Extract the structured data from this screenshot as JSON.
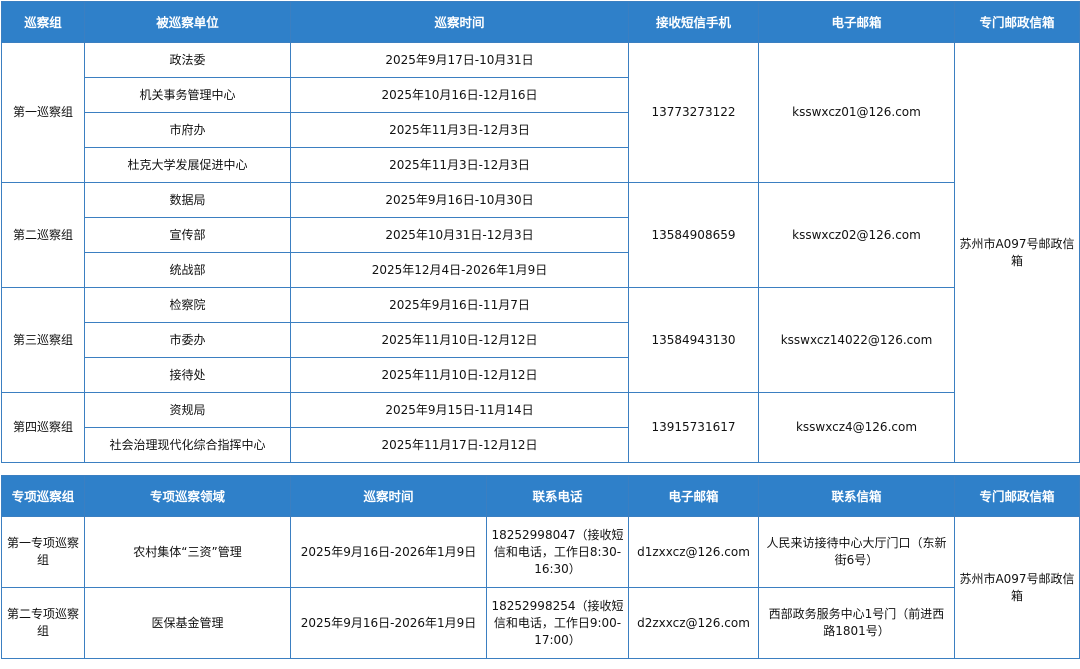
{
  "main_table": {
    "headers": [
      "巡察组",
      "被巡察单位",
      "巡察时间",
      "接收短信手机",
      "电子邮箱",
      "专门邮政信箱"
    ],
    "mailbox": "苏州市A097号邮政信箱",
    "groups": [
      {
        "name": "第一巡察组",
        "phone": "13773273122",
        "email": "ksswxcz01@126.com",
        "units": [
          {
            "unit": "政法委",
            "time": "2025年9月17日-10月31日"
          },
          {
            "unit": "机关事务管理中心",
            "time": "2025年10月16日-12月16日"
          },
          {
            "unit": "市府办",
            "time": "2025年11月3日-12月3日"
          },
          {
            "unit": "杜克大学发展促进中心",
            "time": "2025年11月3日-12月3日"
          }
        ]
      },
      {
        "name": "第二巡察组",
        "phone": "13584908659",
        "email": "ksswxcz02@126.com",
        "units": [
          {
            "unit": "数据局",
            "time": "2025年9月16日-10月30日"
          },
          {
            "unit": "宣传部",
            "time": "2025年10月31日-12月3日"
          },
          {
            "unit": "统战部",
            "time": "2025年12月4日-2026年1月9日"
          }
        ]
      },
      {
        "name": "第三巡察组",
        "phone": "13584943130",
        "email": "ksswxcz14022@126.com",
        "units": [
          {
            "unit": "检察院",
            "time": "2025年9月16日-11月7日"
          },
          {
            "unit": "市委办",
            "time": "2025年11月10日-12月12日"
          },
          {
            "unit": "接待处",
            "time": "2025年11月10日-12月12日"
          }
        ]
      },
      {
        "name": "第四巡察组",
        "phone": "13915731617",
        "email": "ksswxcz4@126.com",
        "units": [
          {
            "unit": "资规局",
            "time": "2025年9月15日-11月14日"
          },
          {
            "unit": "社会治理现代化综合指挥中心",
            "time": "2025年11月17日-12月12日"
          }
        ]
      }
    ]
  },
  "special_table": {
    "headers": [
      "专项巡察组",
      "专项巡察领域",
      "巡察时间",
      "联系电话",
      "电子邮箱",
      "联系信箱",
      "专门邮政信箱"
    ],
    "mailbox": "苏州市A097号邮政信箱",
    "rows": [
      {
        "group": "第一专项巡察组",
        "field": "农村集体“三资”管理",
        "time": "2025年9月16日-2026年1月9日",
        "phone": "18252998047（接收短信和电话，工作日8:30-16:30）",
        "email": "d1zxxcz@126.com",
        "letterbox": "人民来访接待中心大厅门口（东新街6号）"
      },
      {
        "group": "第二专项巡察组",
        "field": "医保基金管理",
        "time": "2025年9月16日-2026年1月9日",
        "phone": "18252998254（接收短信和电话，工作日9:00-17:00）",
        "email": "d2zxxcz@126.com",
        "letterbox": "西部政务服务中心1号门（前进西路1801号）"
      }
    ]
  },
  "colors": {
    "header_bg": "#2f80c9",
    "border": "#3b7fc1",
    "header_text": "#ffffff"
  }
}
